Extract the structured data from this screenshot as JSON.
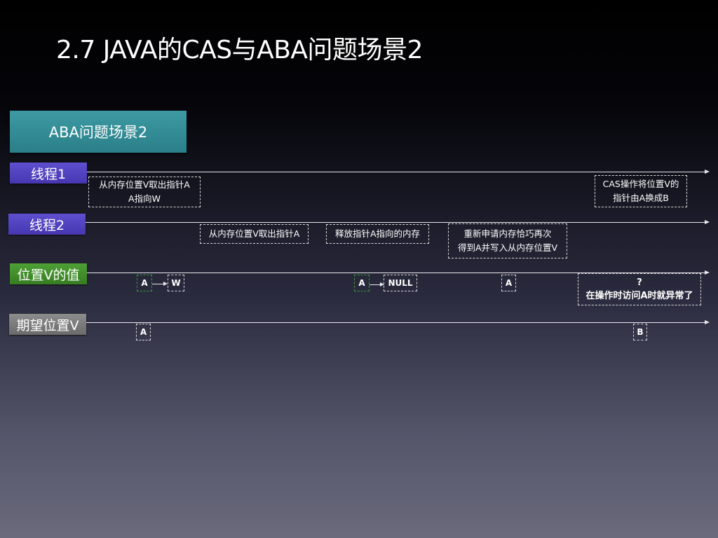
{
  "title": "2.7 JAVA的CAS与ABA问题场景2",
  "scenario_label": "ABA问题场景2",
  "lanes": [
    {
      "label": "线程1"
    },
    {
      "label": "线程2"
    },
    {
      "label": "位置V的值"
    },
    {
      "label": "期望位置V"
    }
  ],
  "thread1_notes": [
    {
      "line1": "从内存位置V取出指针A",
      "line2": "A指向W"
    },
    {
      "line1": "CAS操作将位置V的",
      "line2": "指针由A换成B"
    }
  ],
  "thread2_notes": [
    {
      "text": "从内存位置V取出指针A"
    },
    {
      "text": "释放指针A指向的内存"
    },
    {
      "line1": "重新申请内存恰巧再次",
      "line2": "得到A并写入从内存位置V"
    }
  ],
  "value_cells": [
    "A",
    "W",
    "A",
    "NULL",
    "A"
  ],
  "value_result": {
    "line1": "?",
    "line2": "在操作时访问A时就异常了"
  },
  "expected_cells": [
    "A",
    "B"
  ],
  "colors": {
    "thread_lane": "#4a3cb8",
    "value_lane": "#3f8a2b",
    "expected_lane": "#7a7a7a",
    "scenario": "#2f858f"
  }
}
